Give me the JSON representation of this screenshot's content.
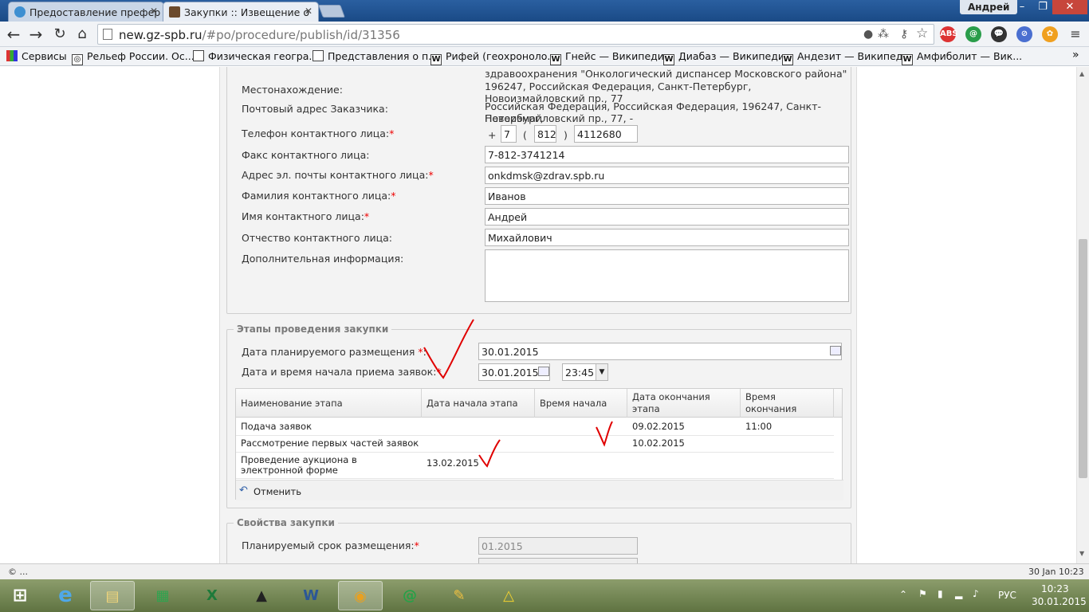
{
  "browser": {
    "tabs": [
      {
        "title": "Предоставление префер",
        "active": false
      },
      {
        "title": "Закупки :: Извещение о",
        "active": true
      }
    ],
    "user": "Андрей",
    "url_host": "new.gz-spb.ru",
    "url_path": "/#po/procedure/publish/id/31356",
    "bookmarks": [
      "Сервисы",
      "Рельеф России. Ос...",
      "Физическая геогра...",
      "Представления о п...",
      "Рифей (геохроноло...",
      "Гнейс — Википедия",
      "Диабаз — Википедия",
      "Андезит — Википед...",
      "Амфиболит — Вик..."
    ]
  },
  "contact": {
    "top_text": "здравоохранения \"Онкологический диспансер Московского района\"",
    "location_label": "Местонахождение:",
    "location_value": "196247, Российская Федерация, Санкт-Петербург, Новоизмайловский пр., 77",
    "postal_label": "Почтовый адрес Заказчика:",
    "postal_value_1": "Российская Федерация, Российская Федерация, 196247, Санкт-Петербург,",
    "postal_value_2": "Новоизмайловский пр., 77, -",
    "phone_label": "Телефон контактного лица:",
    "phone_plus": "+",
    "phone_country": "7",
    "phone_open": "(",
    "phone_code": "812",
    "phone_close": ")",
    "phone_number": "4112680",
    "fax_label": "Факс контактного лица:",
    "fax_value": "7-812-3741214",
    "email_label": "Адрес эл. почты контактного лица:",
    "email_value": "onkdmsk@zdrav.spb.ru",
    "lastname_label": "Фамилия контактного лица:",
    "lastname_value": "Иванов",
    "firstname_label": "Имя контактного лица:",
    "firstname_value": "Андрей",
    "patronymic_label": "Отчество контактного лица:",
    "patronymic_value": "Михайлович",
    "extra_label": "Дополнительная информация:",
    "extra_value": "",
    "req_mark": "*"
  },
  "stages": {
    "legend": "Этапы проведения закупки",
    "plan_date_label": "Дата планируемого размещения",
    "plan_date_suffix": ":",
    "plan_date_value": "30.01.2015",
    "start_label": "Дата и время начала приема заявок:",
    "start_date": "30.01.2015",
    "start_time": "23:45",
    "columns": [
      "Наименование этапа",
      "Дата начала этапа",
      "Время начала",
      "Дата окончания этапа",
      "Время окончания"
    ],
    "rows": [
      {
        "name": "Подача заявок",
        "start_date": "",
        "start_time": "",
        "end_date": "09.02.2015",
        "end_time": "11:00"
      },
      {
        "name": "Рассмотрение первых частей заявок",
        "start_date": "",
        "start_time": "",
        "end_date": "10.02.2015",
        "end_time": ""
      },
      {
        "name": "Проведение аукциона в электронной форме",
        "start_date": "13.02.2015",
        "start_time": "",
        "end_date": "",
        "end_time": ""
      }
    ],
    "cancel_label": "Отменить"
  },
  "props": {
    "legend": "Свойства закупки",
    "term_label": "Планируемый срок размещения:",
    "term_value": "01.2015"
  },
  "status_bar": {
    "left": "© ...",
    "right": "30 Jan 10:23"
  },
  "taskbar": {
    "lang": "РУС",
    "time": "10:23",
    "date": "30.01.2015"
  },
  "colors": {
    "tabbar": "#2a5fa0",
    "required": "#ee0000",
    "annotation": "#e00000",
    "taskbar": "#6b7f4a"
  }
}
